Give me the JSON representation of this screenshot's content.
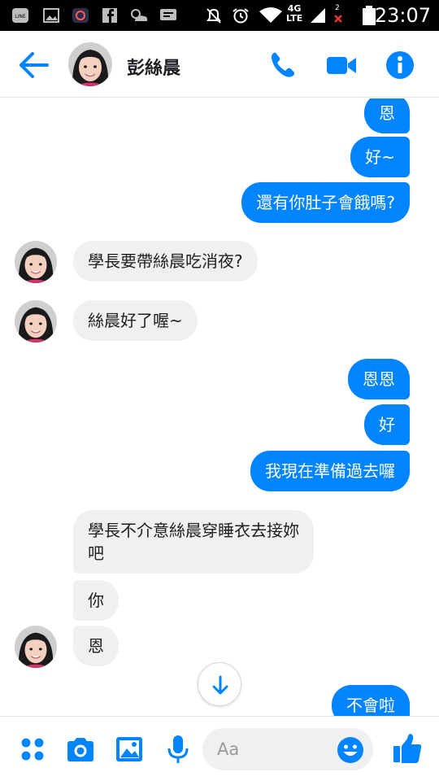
{
  "status_bar": {
    "time": "23:07",
    "network_top": "4G",
    "network_bottom": "LTE",
    "sim_badge": "2",
    "icons": [
      "line-icon",
      "image-icon",
      "app-icon",
      "facebook-icon",
      "weather-icon",
      "chat-icon",
      "mute-icon",
      "alarm-icon",
      "wifi-icon",
      "signal-icon",
      "battery-icon"
    ]
  },
  "header": {
    "contact_name": "彭絲晨",
    "icons": [
      "back-arrow-icon",
      "phone-icon",
      "video-icon",
      "info-icon"
    ]
  },
  "messages": [
    {
      "dir": "out",
      "text": "恩"
    },
    {
      "dir": "out",
      "text": "好~"
    },
    {
      "dir": "out",
      "text": "還有你肚子會餓嗎?"
    },
    {
      "dir": "in",
      "text": "學長要帶絲晨吃消夜?"
    },
    {
      "dir": "in",
      "text": "絲晨好了喔~"
    },
    {
      "dir": "out",
      "text": "恩恩"
    },
    {
      "dir": "out",
      "text": "好"
    },
    {
      "dir": "out",
      "text": "我現在準備過去囉"
    },
    {
      "dir": "in",
      "text": "學長不介意絲晨穿睡衣去接妳"
    },
    {
      "dir": "in",
      "text": "吧"
    },
    {
      "dir": "in",
      "text": "你"
    },
    {
      "dir": "in",
      "text": "恩"
    },
    {
      "dir": "out",
      "text": "不會啦"
    }
  ],
  "composer": {
    "placeholder": "Aa",
    "icons": [
      "apps-icon",
      "camera-icon",
      "gallery-icon",
      "microphone-icon",
      "emoji-icon",
      "thumbs-up-icon"
    ]
  },
  "colors": {
    "accent": "#0084ff",
    "incoming_bubble": "#f1f0f0",
    "status_bar": "#000000"
  }
}
